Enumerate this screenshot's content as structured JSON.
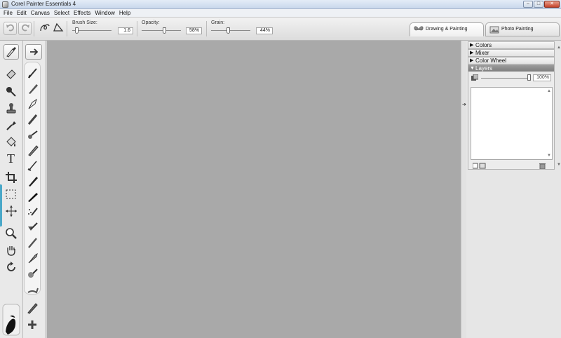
{
  "window": {
    "title": "Corel Painter Essentials 4",
    "buttons": {
      "minimize": "–",
      "maximize": "□",
      "close": "✕"
    }
  },
  "menu": [
    "File",
    "Edit",
    "Canvas",
    "Select",
    "Effects",
    "Window",
    "Help"
  ],
  "property_bar": {
    "undo_icon": "undo-icon",
    "redo_icon": "redo-icon",
    "brush_size": {
      "label": "Brush Size:",
      "value": "1.6",
      "fraction": 0.08
    },
    "opacity": {
      "label": "Opacity:",
      "value": "58%",
      "fraction": 0.58
    },
    "grain": {
      "label": "Grain:",
      "value": "44%",
      "fraction": 0.44
    }
  },
  "workspace_tabs": [
    {
      "label": "Drawing & Painting",
      "active": true
    },
    {
      "label": "Photo Painting",
      "active": false
    }
  ],
  "tools": [
    "brush-icon",
    "eraser-icon",
    "dropper-ball-icon",
    "stamp-icon",
    "eyedropper-icon",
    "paint-bucket-icon",
    "text-icon",
    "crop-icon",
    "rectangle-select-icon",
    "transform-icon",
    "magnifier-icon",
    "grabber-hand-icon",
    "rotate-icon"
  ],
  "panels": [
    {
      "label": "Colors",
      "open": false
    },
    {
      "label": "Mixer",
      "open": false
    },
    {
      "label": "Color Wheel",
      "open": false
    },
    {
      "label": "Layers",
      "open": true
    }
  ],
  "layers": {
    "opacity_value": "100%",
    "opacity_fraction": 1.0
  },
  "colors": {
    "canvas": "#a9a9a9",
    "panel": "#e6e6e6",
    "accent": "#4aa8c8"
  }
}
